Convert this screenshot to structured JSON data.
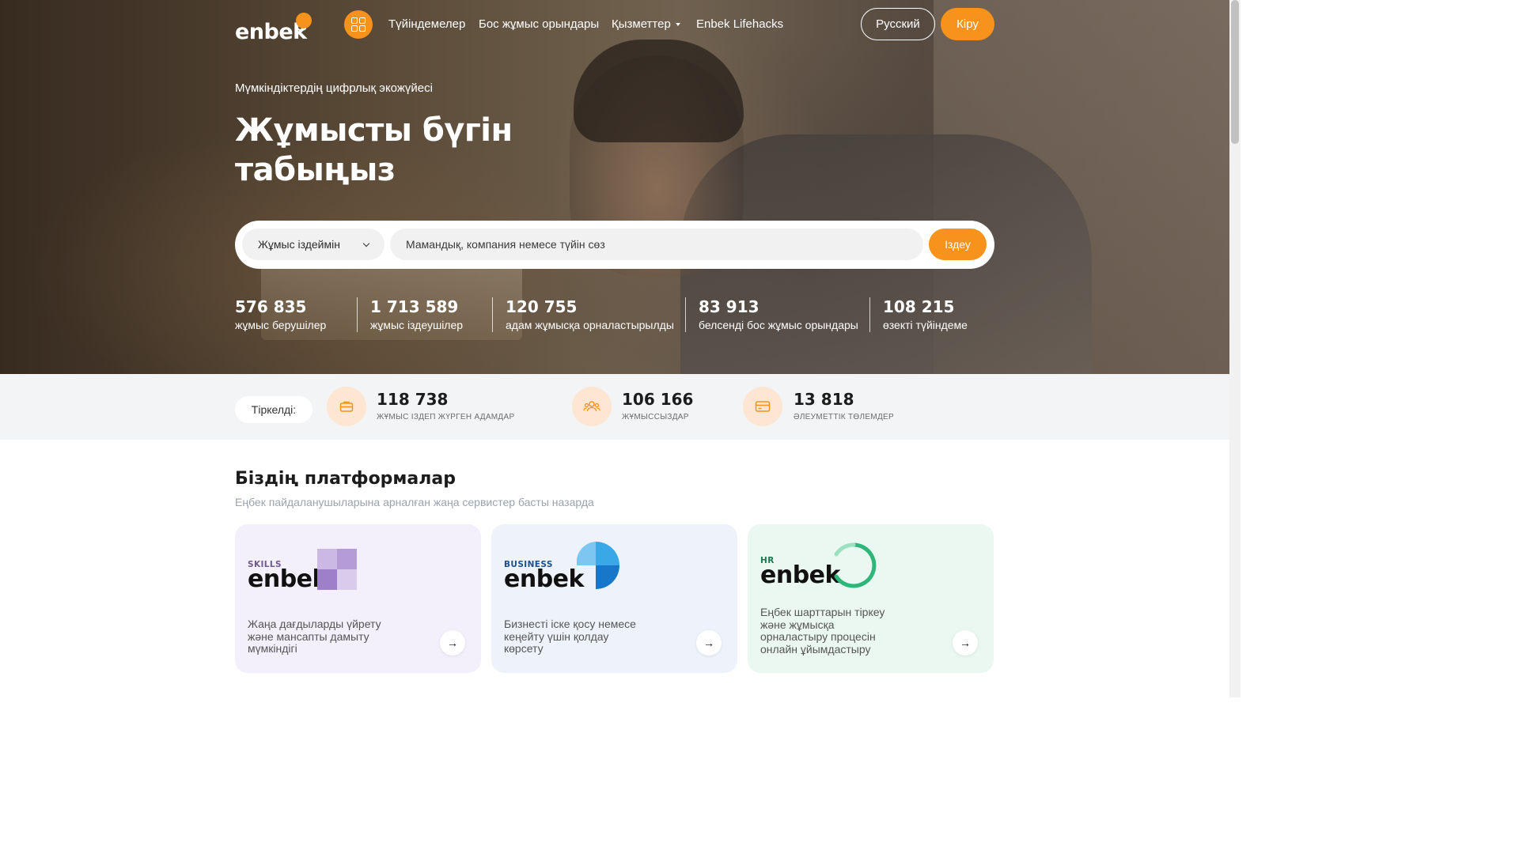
{
  "nav": {
    "logo_text": "enbek",
    "links": [
      "Түйіндемелер",
      "Бос жұмыс орындары",
      "Қызметтер",
      "Enbek Lifehacks"
    ],
    "lang_label": "Русский",
    "login_label": "Кіру"
  },
  "hero": {
    "tagline": "Мүмкіндіктердің цифрлық экожүйесі",
    "headline": "Жұмысты бүгін табыңыз",
    "search": {
      "mode_value": "Жұмыс іздеймін",
      "placeholder": "Мамандық, компания немесе түйін сөз",
      "button_label": "Іздеу"
    },
    "stats": [
      {
        "value": "576 835",
        "label": "жұмыс берушілер"
      },
      {
        "value": "1 713 589",
        "label": "жұмыс іздеушілер"
      },
      {
        "value": "120 755",
        "label": "адам жұмысқа орналастырылды"
      },
      {
        "value": "83 913",
        "label": "белсенді бос жұмыс орындары"
      },
      {
        "value": "108 215",
        "label": "өзекті түйіндеме"
      }
    ]
  },
  "registered": {
    "label": "Тіркелді:",
    "items": [
      {
        "value": "118 738",
        "label": "ЖҰМЫС ІЗДЕП ЖҮРГЕН АДАМДАР",
        "icon": "briefcase-icon"
      },
      {
        "value": "106 166",
        "label": "ЖҰМЫССЫЗДАР",
        "icon": "people-icon"
      },
      {
        "value": "13 818",
        "label": "ӘЛЕУМЕТТІК ТӨЛЕМДЕР",
        "icon": "card-icon"
      }
    ]
  },
  "platforms": {
    "title": "Біздің платформалар",
    "subtitle": "Еңбек пайдаланушыларына арналған жаңа сервистер басты назарда",
    "cards": [
      {
        "sub": "SKILLS",
        "brand": "enbek",
        "desc": "Жаңа дағдыларды үйрету және мансапты дамыту мүмкіндігі"
      },
      {
        "sub": "BUSINESS",
        "brand": "enbek",
        "desc": "Бизнесті іске қосу немесе кеңейту үшін қолдау көрсету"
      },
      {
        "sub": "HR",
        "brand": "enbek",
        "desc": "Еңбек шарттарын тіркеу және жұмысқа орналастыру процесін онлайн ұйымдастыру"
      }
    ]
  },
  "colors": {
    "accent": "#f7931d",
    "skills_bg": "#f3effb",
    "business_bg": "#eef3fb",
    "hr_bg": "#eaf8f1"
  }
}
